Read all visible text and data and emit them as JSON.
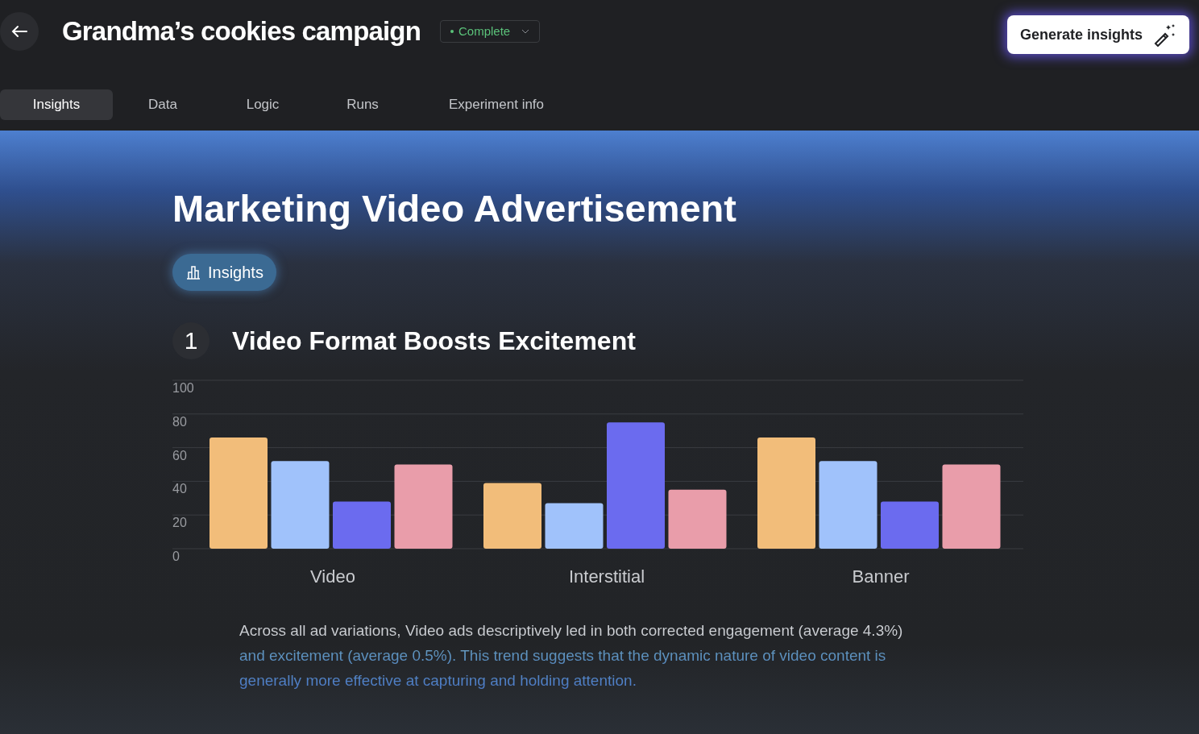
{
  "header": {
    "title": "Grandma’s cookies campaign",
    "status": "Complete",
    "action": "Generate insights"
  },
  "tabs": [
    {
      "label": "Insights",
      "selected": true
    },
    {
      "label": "Data",
      "selected": false
    },
    {
      "label": "Logic",
      "selected": false
    },
    {
      "label": "Runs",
      "selected": false
    },
    {
      "label": "Experiment info",
      "selected": false
    }
  ],
  "content": {
    "title": "Marketing Video Advertisement",
    "section_chip": "Insights",
    "insights": [
      {
        "number": "1",
        "title": "Video Format Boosts Excitement",
        "chart_data": {
          "type": "bar",
          "grid": true,
          "categories": [
            "Video",
            "Interstitial",
            "Banner"
          ],
          "ylim": [
            0,
            100
          ],
          "yticks": [
            0,
            20,
            40,
            60,
            80,
            100
          ],
          "series": [
            {
              "color": "#f2bd7a",
              "values": [
                66,
                39,
                66
              ]
            },
            {
              "color": "#a0c2fb",
              "values": [
                52,
                27,
                52
              ]
            },
            {
              "color": "#6b6bef",
              "values": [
                28,
                75,
                28
              ]
            },
            {
              "color": "#e99daa",
              "values": [
                50,
                35,
                50
              ]
            }
          ]
        },
        "text": "Across all ad variations, Video ads descriptively led in both corrected engagement (average 4.3%) and excitement (average 0.5%). This trend suggests that the dynamic nature of video content is generally more effective at capturing and holding attention."
      }
    ]
  }
}
